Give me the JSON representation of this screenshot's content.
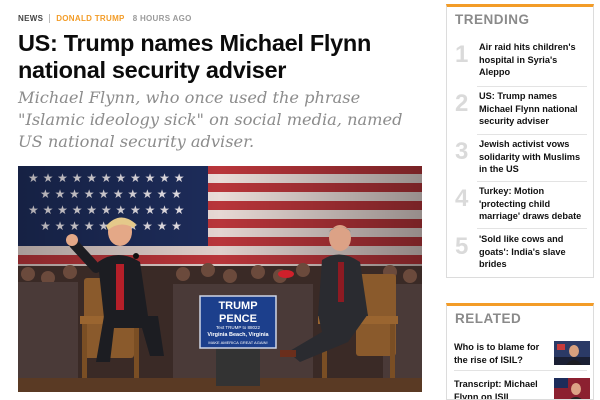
{
  "article": {
    "section": "NEWS",
    "topic": "DONALD TRUMP",
    "time": "8 HOURS AGO",
    "headline": "US: Trump names Michael Flynn national security adviser",
    "standfirst": "Michael Flynn, who once used the phrase \"Islamic ideology sick\" on social media, named US national security adviser.",
    "image": {
      "podium_sign": {
        "line1": "TRUMP",
        "line2": "PENCE",
        "line3": "Text TRUMP to 88022",
        "line4": "Virginia Beach, Virginia",
        "line5": "MAKE AMERICA GREAT AGAIN!"
      }
    }
  },
  "trending": {
    "title": "TRENDING",
    "items": [
      {
        "num": "1",
        "text": "Air raid hits children's hospital in Syria's Aleppo"
      },
      {
        "num": "2",
        "text": "US: Trump names Michael Flynn national security adviser"
      },
      {
        "num": "3",
        "text": "Jewish activist vows solidarity with Muslims in the US"
      },
      {
        "num": "4",
        "text": "Turkey: Motion 'protecting child marriage' draws debate"
      },
      {
        "num": "5",
        "text": "'Sold like cows and goats': India's slave brides"
      }
    ]
  },
  "related": {
    "title": "RELATED",
    "items": [
      {
        "text": "Who is to blame for the rise of ISIL?"
      },
      {
        "text": "Transcript: Michael Flynn on ISIL"
      }
    ]
  },
  "colors": {
    "accent": "#f39c27",
    "headline": "#0b0b0b",
    "standfirst": "#8c8c8c",
    "trending_number": "#dadada",
    "sign_blue": "#1c3f8c",
    "sign_red": "#d0202b"
  }
}
